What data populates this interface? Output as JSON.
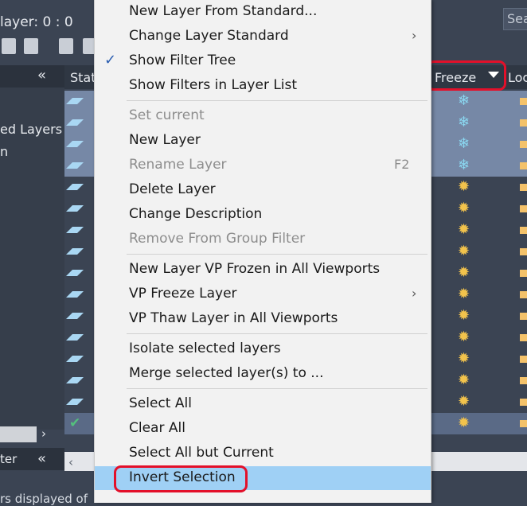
{
  "window": {
    "current_layer": "layer: 0 : 0",
    "search_placeholder": "Sea"
  },
  "tree": {
    "items": [
      "ed Layers",
      "n"
    ],
    "footer_label": "ter"
  },
  "status_bar": {
    "text": "rs displayed of"
  },
  "grid": {
    "columns": {
      "status": "Stat",
      "freeze": "Freeze",
      "lock": "Loc"
    },
    "rows": [
      {
        "selected": true,
        "current": false,
        "freeze": "frozen"
      },
      {
        "selected": true,
        "current": false,
        "freeze": "frozen"
      },
      {
        "selected": true,
        "current": false,
        "freeze": "frozen"
      },
      {
        "selected": true,
        "current": false,
        "freeze": "frozen"
      },
      {
        "selected": false,
        "current": false,
        "freeze": "thawed"
      },
      {
        "selected": false,
        "current": false,
        "freeze": "thawed"
      },
      {
        "selected": false,
        "current": false,
        "freeze": "thawed"
      },
      {
        "selected": false,
        "current": false,
        "freeze": "thawed"
      },
      {
        "selected": false,
        "current": false,
        "freeze": "thawed"
      },
      {
        "selected": false,
        "current": false,
        "freeze": "thawed"
      },
      {
        "selected": false,
        "current": false,
        "freeze": "thawed"
      },
      {
        "selected": false,
        "current": false,
        "freeze": "thawed"
      },
      {
        "selected": false,
        "current": false,
        "freeze": "thawed"
      },
      {
        "selected": false,
        "current": false,
        "freeze": "thawed"
      },
      {
        "selected": false,
        "current": false,
        "freeze": "thawed"
      },
      {
        "selected": true,
        "current": true,
        "freeze": "thawed"
      }
    ]
  },
  "menu": {
    "new_layer_from_standard": "New Layer From Standard...",
    "change_layer_standard": "Change Layer Standard",
    "show_filter_tree": "Show Filter Tree",
    "show_filters_in_layer_list": "Show Filters in Layer List",
    "set_current": "Set current",
    "new_layer": "New Layer",
    "rename_layer": "Rename Layer",
    "rename_layer_shortcut": "F2",
    "delete_layer": "Delete Layer",
    "change_description": "Change Description",
    "remove_from_group_filter": "Remove From Group Filter",
    "new_layer_vp_frozen": "New Layer VP Frozen in All Viewports",
    "vp_freeze_layer": "VP Freeze Layer",
    "vp_thaw_layer": "VP Thaw Layer in All Viewports",
    "isolate_selected_layers": "Isolate selected layers",
    "merge_selected_layers": "Merge selected layer(s) to ...",
    "select_all": "Select All",
    "clear_all": "Clear All",
    "select_all_but_current": "Select All but Current",
    "invert_selection": "Invert Selection"
  },
  "icons": {
    "submenu_arrow": "chevron-right-icon",
    "check": "checkmark-icon",
    "frozen": "snowflake-icon",
    "thawed": "sun-icon",
    "lock": "lock-icon",
    "layer_status": "layer-status-icon"
  },
  "colors": {
    "highlight_outline": "#e3102a",
    "menu_hover": "#9fd0f5",
    "selected_row": "#7688a6",
    "snowflake": "#8ad7f0",
    "sun": "#f2c34c"
  }
}
